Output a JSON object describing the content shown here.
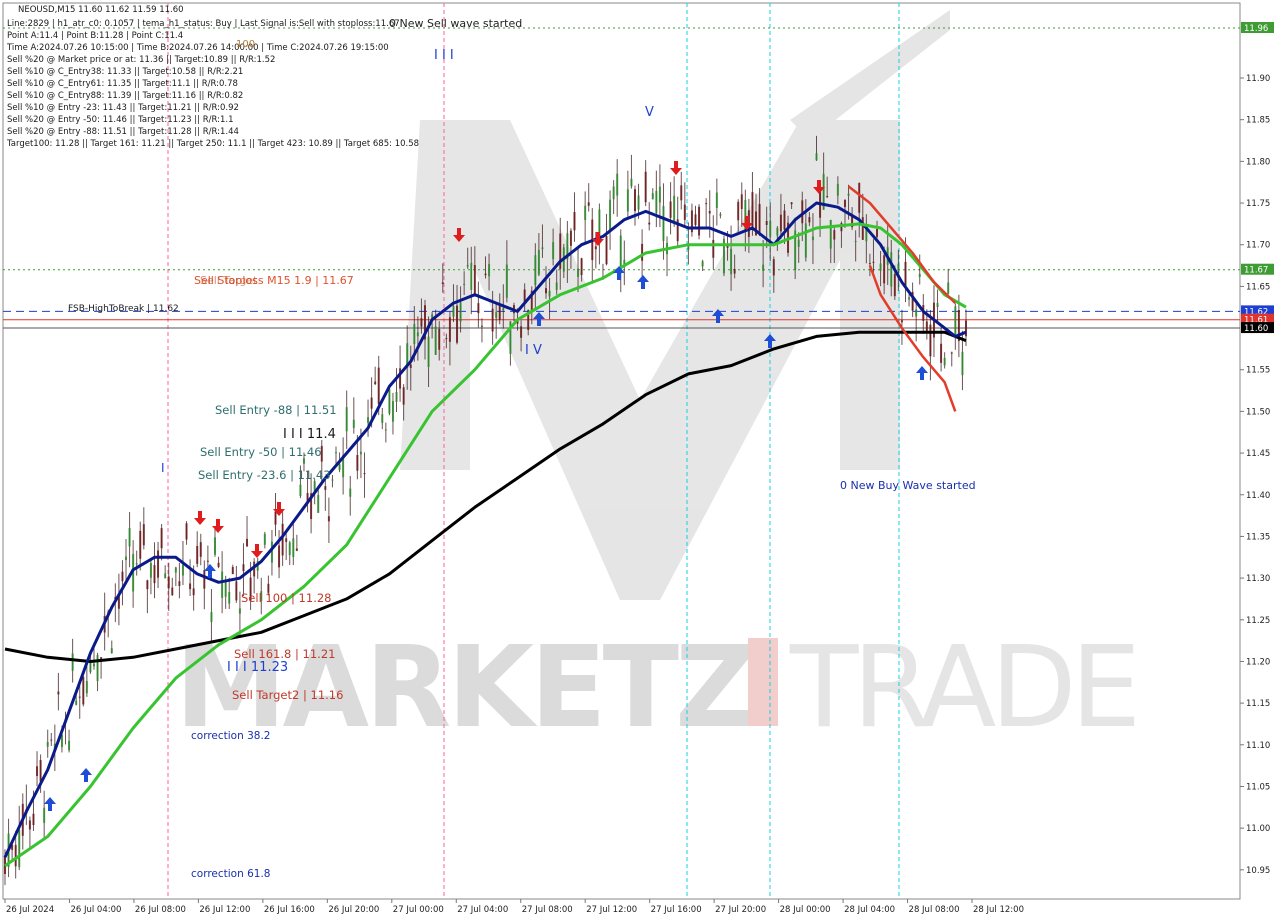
{
  "header": {
    "symbol_line": "NEOUSD,M15  11.60 11.62 11.59 11.60",
    "info_lines": [
      "Line:2829 | h1_atr_c0: 0.1057 | tema_h1_status: Buy | Last Signal is:Sell with stoploss:11.67",
      "Point A:11.4 | Point B:11.28 | Point C:11.4",
      "Time A:2024.07.26 10:15:00 | Time B:2024.07.26 14:00:00 | Time C:2024.07.26 19:15:00",
      "Sell %20 @ Market price or at: 11.36 || Target:10.89 || R/R:1.52",
      "Sell %10 @ C_Entry38: 11.33 || Target:10.58 || R/R:2.21",
      "Sell %10 @ C_Entry61: 11.35 || Target:11.1 || R/R:0.78",
      "Sell %10 @ C_Entry88: 11.39 || Target:11.16 || R/R:0.82",
      "Sell %10 @ Entry -23: 11.43 || Target:11.21 || R/R:0.92",
      "Sell %20 @ Entry -50: 11.46 || Target:11.23 || R/R:1.1",
      "Sell %20 @ Entry -88: 11.51 || Target:11.28 || R/R:1.44",
      "Target100: 11.28 || Target 161: 11.21 || Target 250: 11.1 || Target 423: 10.89 || Target 685: 10.58"
    ],
    "wave_notice": "0 New Sell wave started"
  },
  "annotations": {
    "label_100": "100",
    "sell_stoploss": "Sell Stoploss M15 1.9 | 11.67",
    "sell_target_overlap": "Sell Target",
    "fsb_high": "FSB-HighToBreak | 11.62",
    "sell_entry_88": "Sell Entry -88 | 11.51",
    "sell_entry_50": "Sell Entry -50 | 11.46",
    "sell_entry_23": "Sell Entry -23.6 | 11.43",
    "sell_100": "Sell 100 | 11.28",
    "sell_161": "Sell 161.8 | 11.21",
    "sell_target2": "Sell Target2 | 11.16",
    "wave_11_4": "I I I 11.4",
    "wave_11_23": "I I I 11.23",
    "wave_I_top": "I I I",
    "wave_V_top": "V",
    "wave_I": "I",
    "wave_IV": "I V",
    "correction_38": "correction 38.2",
    "correction_61": "correction 61.8",
    "new_buy_wave": "0 New Buy Wave started"
  },
  "watermark": {
    "brand_left": "MARKETZ",
    "brand_right": "TRADE"
  },
  "price_tags": [
    {
      "label": "11.96",
      "value": 11.96,
      "color": "#3f9c35"
    },
    {
      "label": "11.67",
      "value": 11.67,
      "color": "#3f9c35"
    },
    {
      "label": "11.62",
      "value": 11.62,
      "color": "#1f3fd0"
    },
    {
      "label": "11.61",
      "value": 11.61,
      "color": "#e0342c"
    },
    {
      "label": "11.60",
      "value": 11.6,
      "color": "#000000"
    }
  ],
  "chart_data": {
    "type": "line",
    "title": "NEOUSD,M15",
    "ylim": [
      10.915,
      11.99
    ],
    "y_ticks": [
      "11.90",
      "11.85",
      "11.80",
      "11.75",
      "11.70",
      "11.65",
      "11.55",
      "11.50",
      "11.45",
      "11.40",
      "11.35",
      "11.30",
      "11.25",
      "11.20",
      "11.15",
      "11.10",
      "11.05",
      "11.00",
      "10.95"
    ],
    "x_ticks": [
      "26 Jul 2024",
      "26 Jul 04:00",
      "26 Jul 08:00",
      "26 Jul 12:00",
      "26 Jul 16:00",
      "26 Jul 20:00",
      "27 Jul 00:00",
      "27 Jul 04:00",
      "27 Jul 08:00",
      "27 Jul 12:00",
      "27 Jul 16:00",
      "27 Jul 20:00",
      "28 Jul 00:00",
      "28 Jul 04:00",
      "28 Jul 08:00",
      "28 Jul 12:00"
    ],
    "levels": [
      {
        "name": "FSB-HighToBreak",
        "value": 11.62,
        "color": "#1f3fd0",
        "style": "dashed"
      },
      {
        "name": "Sell Stoploss",
        "value": 11.67,
        "color": "#3f9c35",
        "style": "dotted"
      },
      {
        "name": "Top",
        "value": 11.96,
        "color": "#3f9c35",
        "style": "dotted"
      },
      {
        "name": "Red",
        "value": 11.61,
        "color": "#e0342c",
        "style": "solid"
      },
      {
        "name": "Last",
        "value": 11.6,
        "color": "#555555",
        "style": "solid"
      }
    ],
    "series": [
      {
        "color": "#000000",
        "points": [
          [
            0,
            11.215
          ],
          [
            4,
            11.205
          ],
          [
            8,
            11.2
          ],
          [
            12,
            11.205
          ],
          [
            16,
            11.215
          ],
          [
            20,
            11.225
          ],
          [
            24,
            11.235
          ],
          [
            28,
            11.255
          ],
          [
            32,
            11.275
          ],
          [
            36,
            11.305
          ],
          [
            40,
            11.345
          ],
          [
            44,
            11.385
          ],
          [
            48,
            11.42
          ],
          [
            52,
            11.455
          ],
          [
            56,
            11.485
          ],
          [
            60,
            11.52
          ],
          [
            64,
            11.545
          ],
          [
            68,
            11.555
          ],
          [
            72,
            11.575
          ],
          [
            76,
            11.59
          ],
          [
            80,
            11.595
          ],
          [
            84,
            11.595
          ],
          [
            88,
            11.595
          ],
          [
            90,
            11.585
          ]
        ]
      },
      {
        "color": "#0a1a8a",
        "points": [
          [
            0,
            10.965
          ],
          [
            2,
            11.02
          ],
          [
            4,
            11.07
          ],
          [
            6,
            11.14
          ],
          [
            8,
            11.21
          ],
          [
            10,
            11.265
          ],
          [
            12,
            11.31
          ],
          [
            14,
            11.325
          ],
          [
            16,
            11.325
          ],
          [
            18,
            11.305
          ],
          [
            20,
            11.295
          ],
          [
            22,
            11.3
          ],
          [
            24,
            11.32
          ],
          [
            26,
            11.35
          ],
          [
            28,
            11.385
          ],
          [
            30,
            11.42
          ],
          [
            32,
            11.45
          ],
          [
            34,
            11.48
          ],
          [
            36,
            11.53
          ],
          [
            38,
            11.56
          ],
          [
            40,
            11.61
          ],
          [
            42,
            11.63
          ],
          [
            44,
            11.64
          ],
          [
            46,
            11.63
          ],
          [
            48,
            11.62
          ],
          [
            50,
            11.65
          ],
          [
            52,
            11.68
          ],
          [
            54,
            11.7
          ],
          [
            56,
            11.71
          ],
          [
            58,
            11.73
          ],
          [
            60,
            11.74
          ],
          [
            62,
            11.73
          ],
          [
            64,
            11.72
          ],
          [
            66,
            11.72
          ],
          [
            68,
            11.71
          ],
          [
            70,
            11.72
          ],
          [
            72,
            11.7
          ],
          [
            74,
            11.73
          ],
          [
            76,
            11.75
          ],
          [
            78,
            11.745
          ],
          [
            80,
            11.73
          ],
          [
            82,
            11.7
          ],
          [
            84,
            11.655
          ],
          [
            86,
            11.62
          ],
          [
            88,
            11.6
          ],
          [
            89,
            11.59
          ],
          [
            90,
            11.595
          ]
        ]
      },
      {
        "color": "#38c330",
        "points": [
          [
            0,
            10.955
          ],
          [
            4,
            10.99
          ],
          [
            8,
            11.05
          ],
          [
            12,
            11.12
          ],
          [
            16,
            11.18
          ],
          [
            20,
            11.22
          ],
          [
            24,
            11.25
          ],
          [
            28,
            11.29
          ],
          [
            32,
            11.34
          ],
          [
            36,
            11.42
          ],
          [
            40,
            11.5
          ],
          [
            44,
            11.55
          ],
          [
            48,
            11.61
          ],
          [
            52,
            11.64
          ],
          [
            56,
            11.66
          ],
          [
            60,
            11.69
          ],
          [
            64,
            11.7
          ],
          [
            68,
            11.7
          ],
          [
            72,
            11.7
          ],
          [
            76,
            11.72
          ],
          [
            80,
            11.725
          ],
          [
            82,
            11.72
          ],
          [
            84,
            11.7
          ],
          [
            86,
            11.67
          ],
          [
            88,
            11.64
          ],
          [
            90,
            11.625
          ]
        ]
      },
      {
        "color": "#e23c2a",
        "points": [
          [
            79,
            11.77
          ],
          [
            81,
            11.75
          ],
          [
            83,
            11.72
          ],
          [
            85,
            11.69
          ],
          [
            87,
            11.655
          ],
          [
            89,
            11.63
          ]
        ]
      },
      {
        "color": "#e23c2a",
        "points": [
          [
            81,
            11.675
          ],
          [
            82,
            11.64
          ],
          [
            84,
            11.6
          ],
          [
            86,
            11.565
          ],
          [
            88,
            11.535
          ],
          [
            89,
            11.5
          ]
        ]
      }
    ]
  }
}
